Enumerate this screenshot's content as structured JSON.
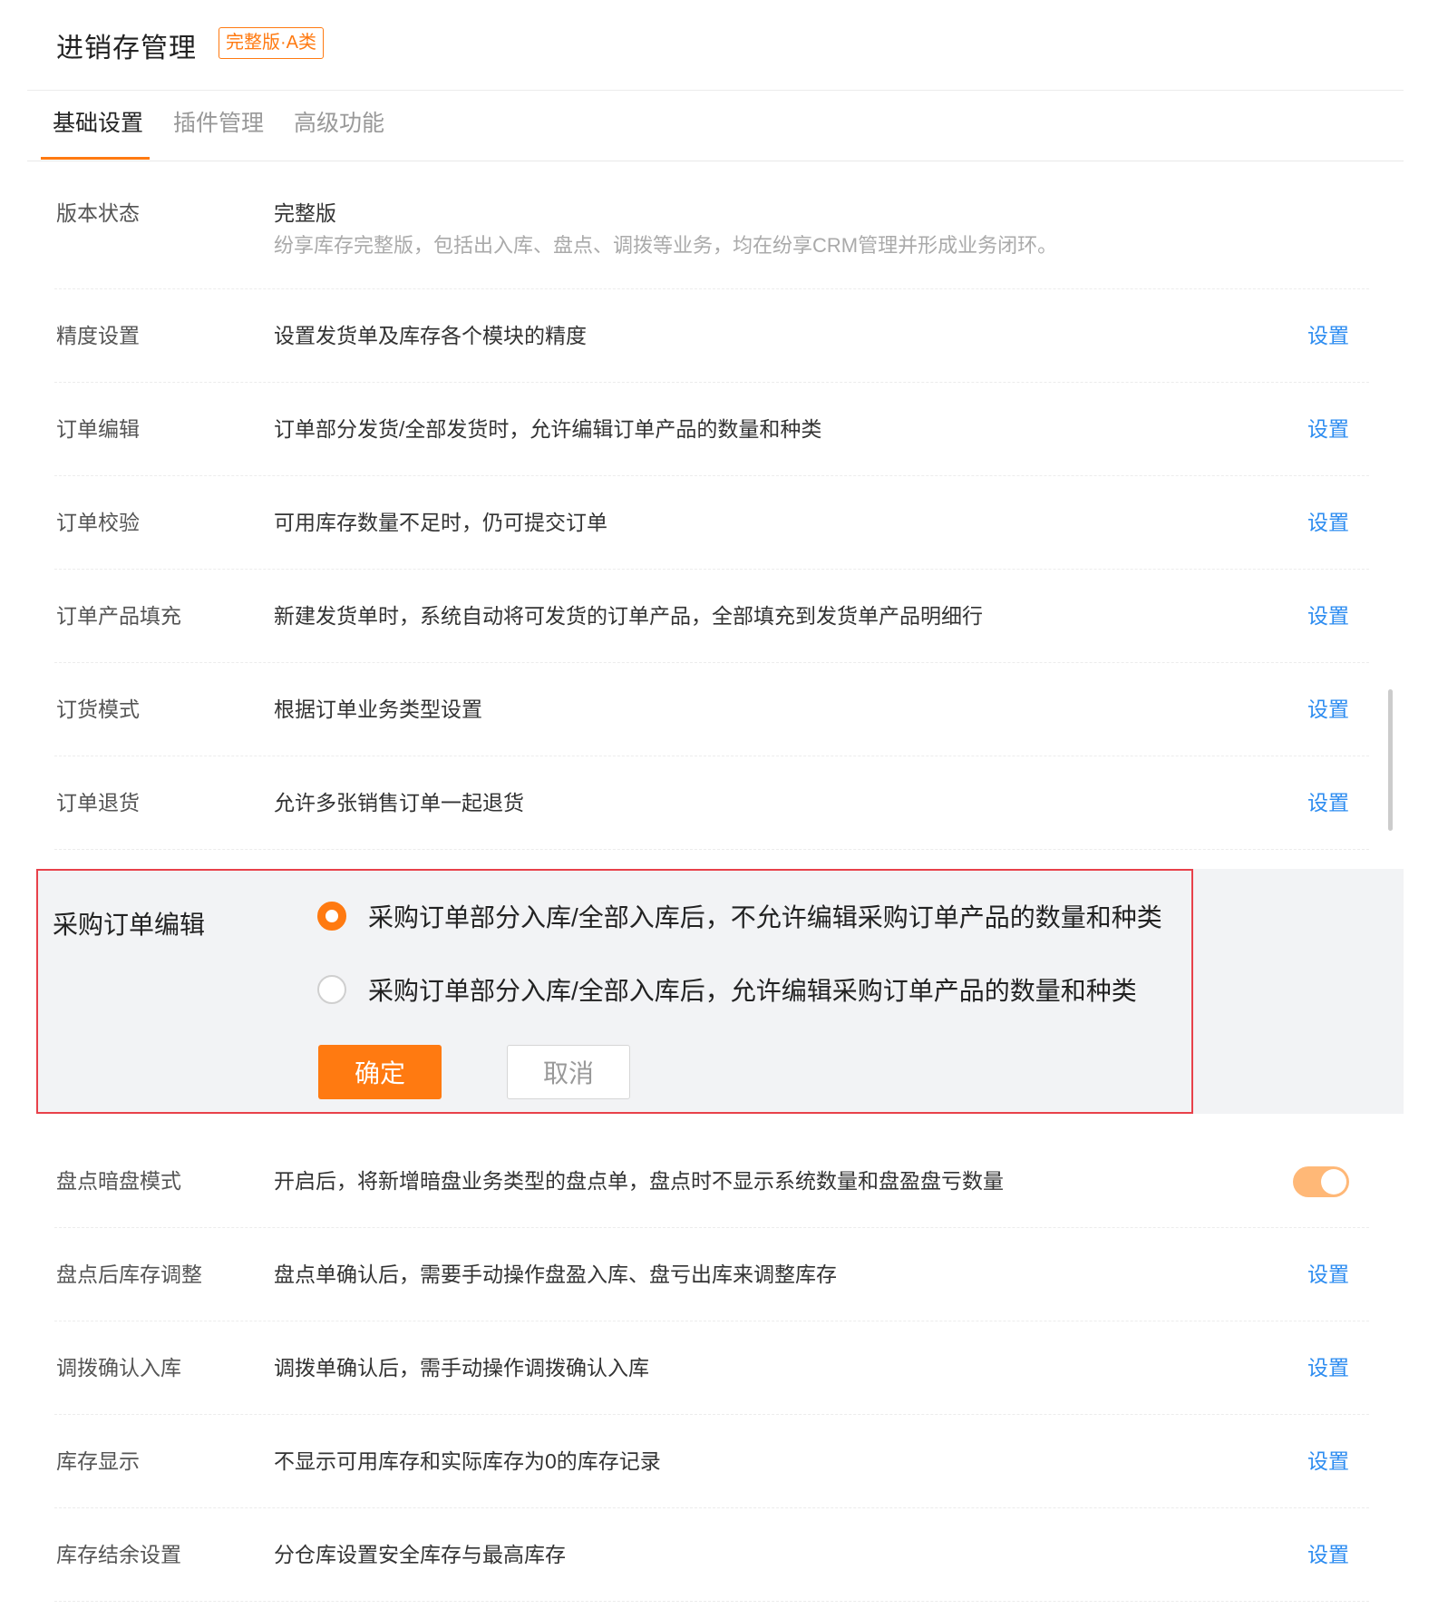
{
  "header": {
    "title": "进销存管理",
    "badge": "完整版·A类"
  },
  "tabs": [
    {
      "label": "基础设置",
      "active": true
    },
    {
      "label": "插件管理",
      "active": false
    },
    {
      "label": "高级功能",
      "active": false
    }
  ],
  "version": {
    "label": "版本状态",
    "value": "完整版",
    "description": "纷享库存完整版，包括出入库、盘点、调拨等业务，均在纷享CRM管理并形成业务闭环。"
  },
  "settings_top": [
    {
      "label": "精度设置",
      "desc": "设置发货单及库存各个模块的精度",
      "action": "设置"
    },
    {
      "label": "订单编辑",
      "desc": "订单部分发货/全部发货时，允许编辑订单产品的数量和种类",
      "action": "设置"
    },
    {
      "label": "订单校验",
      "desc": "可用库存数量不足时，仍可提交订单",
      "action": "设置"
    },
    {
      "label": "订单产品填充",
      "desc": "新建发货单时，系统自动将可发货的订单产品，全部填充到发货单产品明细行",
      "action": "设置"
    },
    {
      "label": "订货模式",
      "desc": "根据订单业务类型设置",
      "action": "设置"
    },
    {
      "label": "订单退货",
      "desc": "允许多张销售订单一起退货",
      "action": "设置"
    }
  ],
  "purchase_edit": {
    "label": "采购订单编辑",
    "options": [
      {
        "text": "采购订单部分入库/全部入库后，不允许编辑采购订单产品的数量和种类",
        "checked": true
      },
      {
        "text": "采购订单部分入库/全部入库后，允许编辑采购订单产品的数量和种类",
        "checked": false
      }
    ],
    "confirm_label": "确定",
    "cancel_label": "取消"
  },
  "settings_bottom": [
    {
      "label": "盘点暗盘模式",
      "desc": "开启后，将新增暗盘业务类型的盘点单，盘点时不显示系统数量和盘盈盘亏数量",
      "toggle_on": true
    },
    {
      "label": "盘点后库存调整",
      "desc": "盘点单确认后，需要手动操作盘盈入库、盘亏出库来调整库存",
      "action": "设置"
    },
    {
      "label": "调拨确认入库",
      "desc": "调拨单确认后，需手动操作调拨确认入库",
      "action": "设置"
    },
    {
      "label": "库存显示",
      "desc": "不显示可用库存和实际库存为0的库存记录",
      "action": "设置"
    },
    {
      "label": "库存结余设置",
      "desc": "分仓库设置安全库存与最高库存",
      "action": "设置"
    }
  ],
  "colors": {
    "accent": "#ff7a11",
    "link": "#2d8cf0",
    "highlight_border": "#e8414a",
    "panel_bg": "#f2f3f5"
  }
}
